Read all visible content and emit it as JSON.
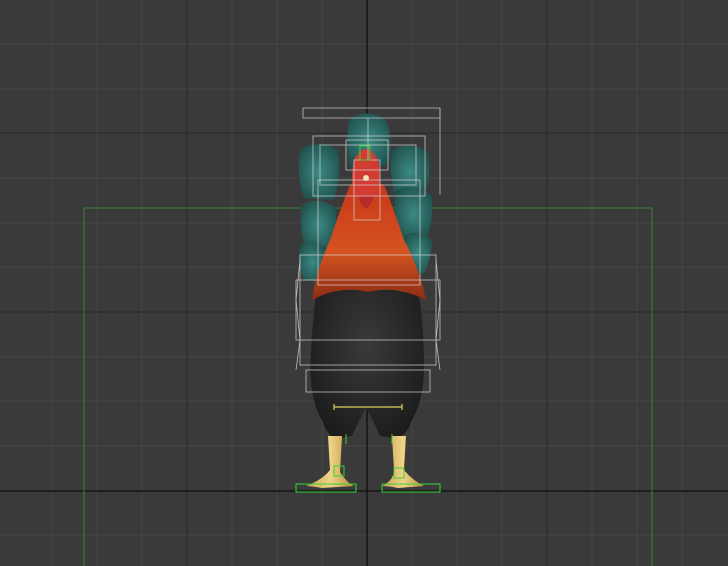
{
  "viewport": {
    "view": "front",
    "grid_visible": true,
    "model": "rooster",
    "colors": {
      "background": "#3a3a3a",
      "grid_minor": "#4a4a4a",
      "grid_major": "#2a2a2a",
      "axis": "#111111",
      "bounds": "#3f7a3f",
      "wireframe": "#d8d8d8",
      "rig_green": "#3cd23c",
      "rig_yellow": "#e0d060",
      "tail": "#2f6f6a",
      "neck": "#c2451a",
      "body": "#2a2a2a",
      "comb": "#d83a30",
      "legs": "#e2c06a"
    }
  }
}
